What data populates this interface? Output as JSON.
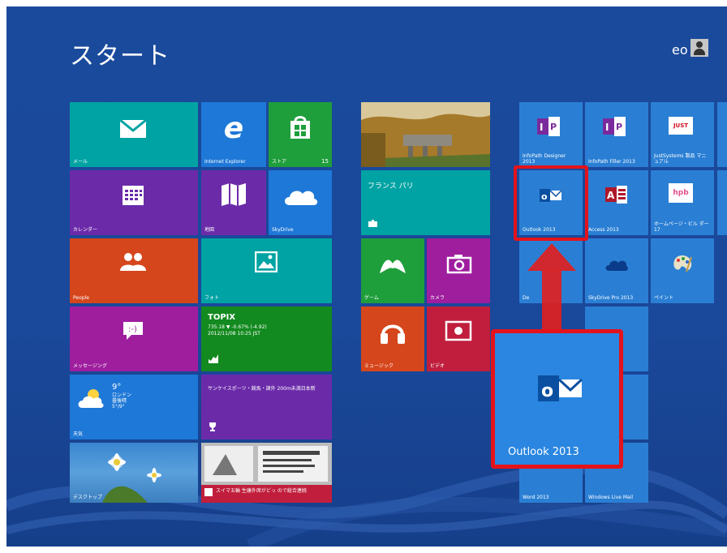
{
  "header": {
    "title": "スタート",
    "user_name": "eo"
  },
  "group1": {
    "mail": "メール",
    "ie": "Internet Explorer",
    "store": "ストア",
    "store_badge": "15",
    "calendar": "カレンダー",
    "maps": "地図",
    "skydrive": "SkyDrive",
    "people": "People",
    "photos": "フォト",
    "messaging": "メッセージング",
    "finance_title": "TOPIX",
    "finance_line1": "735.18 ▼ -0.67% (-4.92)",
    "finance_line2": "2012/11/08 10:25 JST",
    "weather_temp": "9°",
    "weather_line1": "ロンドン",
    "weather_line2": "曇後晴",
    "weather_line3": "5°/9°",
    "weather": "天気",
    "sports_text": "サンケイスポーツ・競馬・諸外 200m未満日本新",
    "desktop": "デスクトップ",
    "news": "スイマ五輪 生康外席がどっ ので総合連続"
  },
  "group2": {
    "travel_label": "フランス パリ",
    "games": "ゲーム",
    "camera": "カメラ",
    "music": "ミュージック",
    "video": "ビデオ"
  },
  "group3": {
    "infopath_designer": "InfoPath Designer 2013",
    "infopath_filler": "InfoPath Filler 2013",
    "justsystems": "JustSystems 製品 マニュアル",
    "outlook_small": "Outlook 2013",
    "access": "Access 2013",
    "homepage": "ホームページ・ビル ダー17",
    "skydrive_pro": "SkyDrive Pro 2013",
    "paint": "ペイント",
    "word": "Word 2013",
    "live_mail": "Windows Live Mail",
    "partial_de": "De"
  },
  "callout": {
    "label": "Outlook 2013"
  },
  "colors": {
    "background": "#1a4a9c",
    "highlight": "#e3131b",
    "outlook": "#0072c6"
  }
}
